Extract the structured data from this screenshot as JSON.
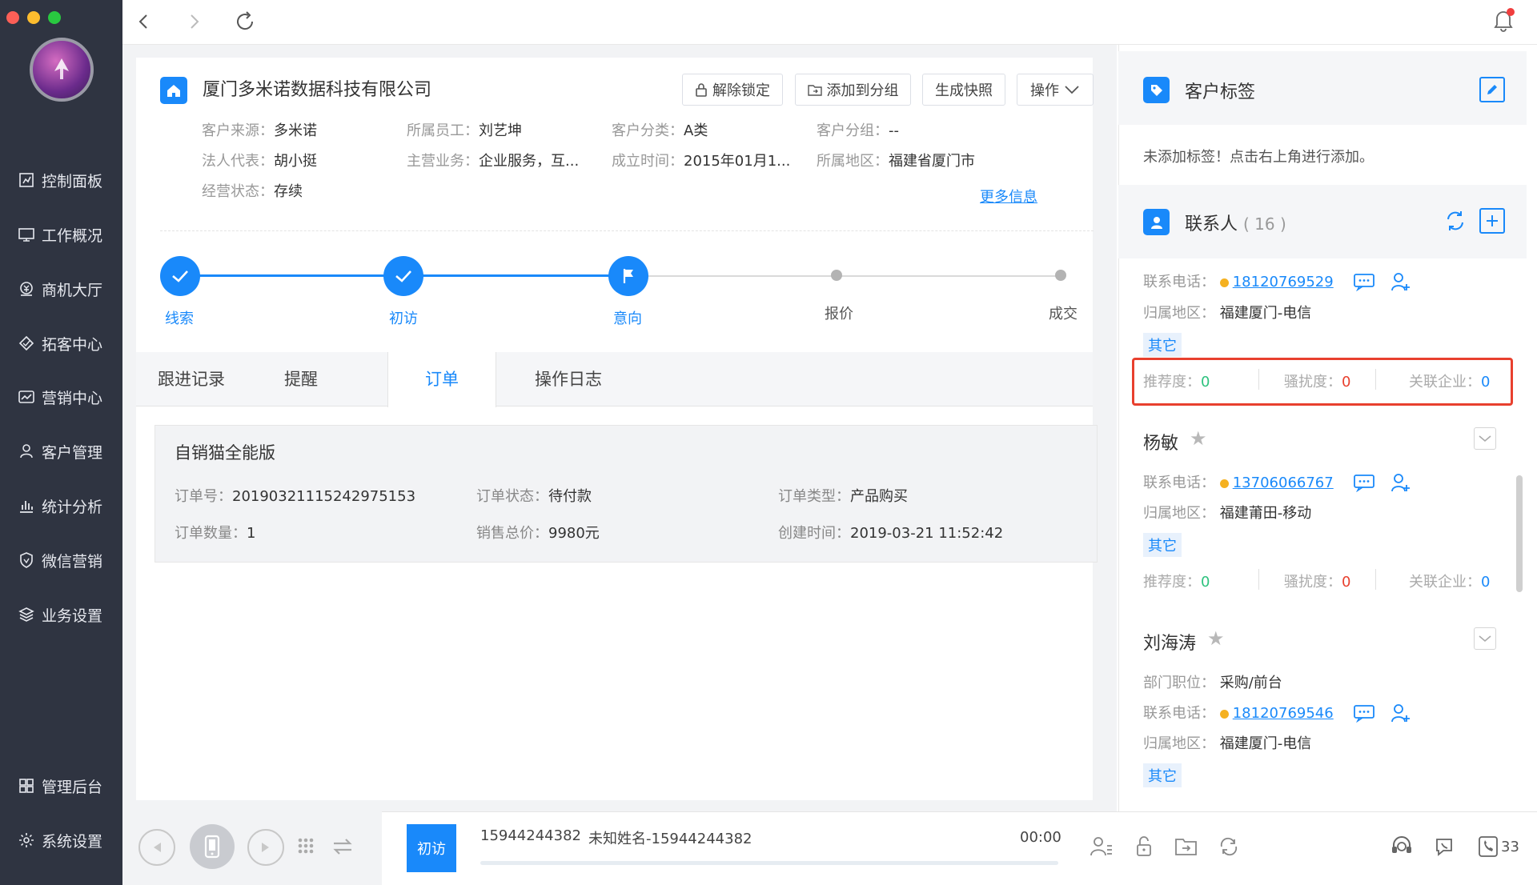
{
  "sidebar": {
    "items": [
      {
        "label": "控制面板",
        "icon": "dashboard-icon"
      },
      {
        "label": "工作概况",
        "icon": "monitor-icon"
      },
      {
        "label": "商机大厅",
        "icon": "coin-icon"
      },
      {
        "label": "拓客中心",
        "icon": "diamond-icon"
      },
      {
        "label": "营销中心",
        "icon": "trend-icon"
      },
      {
        "label": "客户管理",
        "icon": "person-icon"
      },
      {
        "label": "统计分析",
        "icon": "bar-chart-icon"
      },
      {
        "label": "微信营销",
        "icon": "shield-icon"
      },
      {
        "label": "业务设置",
        "icon": "layers-icon"
      },
      {
        "label": "管理后台",
        "icon": "grid-icon"
      },
      {
        "label": "系统设置",
        "icon": "gear-icon"
      }
    ]
  },
  "company": {
    "name": "厦门多米诺数据科技有限公司",
    "buttons": {
      "unlock": "解除锁定",
      "add_group": "添加到分组",
      "snapshot": "生成快照",
      "operate": "操作"
    },
    "fields": {
      "source_k": "客户来源：",
      "source_v": "多米诺",
      "staff_k": "所属员工：",
      "staff_v": "刘艺坤",
      "category_k": "客户分类：",
      "category_v": "A类",
      "group_k": "客户分组：",
      "group_v": "--",
      "legal_k": "法人代表：",
      "legal_v": "胡小挺",
      "business_k": "主营业务：",
      "business_v": "企业服务，互...",
      "founded_k": "成立时间：",
      "founded_v": "2015年01月1...",
      "region_k": "所属地区：",
      "region_v": "福建省厦门市",
      "status_k": "经营状态：",
      "status_v": "存续"
    },
    "more_link": "更多信息"
  },
  "steps": {
    "s1": "线索",
    "s2": "初访",
    "s3": "意向",
    "s4": "报价",
    "s5": "成交"
  },
  "tabs": {
    "t1": "跟进记录",
    "t2": "提醒",
    "t3": "订单",
    "t4": "操作日志"
  },
  "order": {
    "title": "自销猫全能版",
    "no_k": "订单号：",
    "no_v": "20190321115242975153",
    "status_k": "订单状态：",
    "status_v": "待付款",
    "type_k": "订单类型：",
    "type_v": "产品购买",
    "qty_k": "订单数量：",
    "qty_v": "1",
    "total_k": "销售总价：",
    "total_v": "9980元",
    "created_k": "创建时间：",
    "created_v": "2019-03-21 11:52:42"
  },
  "tags_panel": {
    "title": "客户标签",
    "empty": "未添加标签！点击右上角进行添加。"
  },
  "contacts_panel": {
    "title": "联系人",
    "count": "( 16 )",
    "phone_k": "联系电话：",
    "region_k": "归属地区：",
    "dept_k": "部门职位：",
    "rec_k": "推荐度：",
    "harass_k": "骚扰度：",
    "corp_k": "关联企业：",
    "c1": {
      "phone": "18120769529",
      "region": "福建厦门-电信",
      "tag": "其它",
      "rec": "0",
      "harass": "0",
      "corp": "0"
    },
    "c2": {
      "name": "杨敏",
      "phone": "13706066767",
      "region": "福建莆田-移动",
      "tag": "其它",
      "rec": "0",
      "harass": "0",
      "corp": "0"
    },
    "c3": {
      "name": "刘海涛",
      "dept": "采购/前台",
      "phone": "18120769546",
      "region": "福建厦门-电信",
      "tag": "其它"
    }
  },
  "callbar": {
    "stage": "初访",
    "number": "15944244382",
    "contact": "未知姓名-15944244382",
    "time": "00:00",
    "count": "33"
  },
  "colors": {
    "accent": "#1989fa",
    "sidebar": "#2f3441",
    "danger": "#e8402e",
    "success": "#2ec27e"
  }
}
